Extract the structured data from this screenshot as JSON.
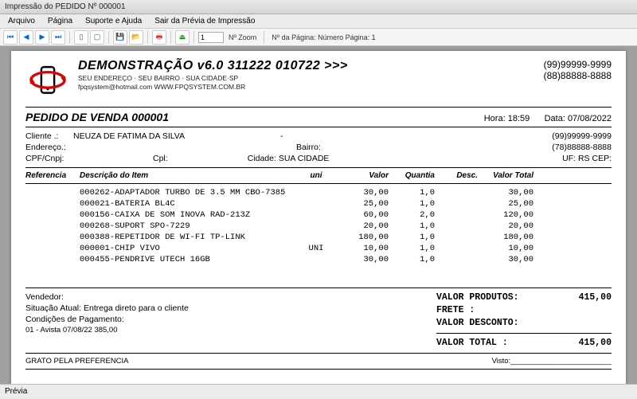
{
  "window": {
    "title": "Impressão do PEDIDO Nº 000001"
  },
  "menu": {
    "arquivo": "Arquivo",
    "pagina": "Página",
    "suporte": "Suporte e Ajuda",
    "sair": "Sair da Prévia de Impressão"
  },
  "toolbar": {
    "zoom_value": "1",
    "zoom_label": "Nº Zoom",
    "page_label": "Nº da Página: Número Página: 1"
  },
  "header": {
    "company_line": "DEMONSTRAÇÃO v6.0 311222 010722 >>>",
    "address": "SEU ENDEREÇO · SEU BAIRRO · SUA CIDADE·SP",
    "contact": "fpqsystem@hotmail.com  WWW.FPQSYSTEM.COM.BR",
    "phone1": "(99)99999-9999",
    "phone2": "(88)88888-8888"
  },
  "doc": {
    "title": "PEDIDO DE VENDA 000001",
    "hora_label": "Hora:",
    "hora": "18:59",
    "data_label": "Data:",
    "data": "07/08/2022"
  },
  "client": {
    "cliente_label": "Cliente   .:",
    "cliente": "NEUZA DE FATIMA DA SILVA",
    "cliente_dash": "-",
    "endereco_label": "Endereço.:",
    "bairro_label": "Bairro:",
    "cpf_label": "CPF/Cnpj:",
    "cpl_label": "Cpl:",
    "cidade_label": "Cidade:",
    "cidade": "SUA CIDADE",
    "uf_label": "UF:",
    "uf": "RS",
    "cep_label": "CEP:",
    "phone1": "(99)99999-9999",
    "phone2": "(78)88888-8888"
  },
  "cols": {
    "ref": "Referencia",
    "desc": "Descrição do Item",
    "uni": "uni",
    "valor": "Valor",
    "quant": "Quantia",
    "desc2": "Desc.",
    "total": "Valor Total"
  },
  "items": [
    {
      "ref": "",
      "desc": "000262-ADAPTADOR TURBO DE 3.5 MM CBO-7385",
      "uni": "",
      "valor": "30,00",
      "quant": "1,0",
      "descv": "",
      "total": "30,00"
    },
    {
      "ref": "",
      "desc": "000021-BATERIA BL4C",
      "uni": "",
      "valor": "25,00",
      "quant": "1,0",
      "descv": "",
      "total": "25,00"
    },
    {
      "ref": "",
      "desc": "000156-CAIXA DE SOM INOVA RAD-213Z",
      "uni": "",
      "valor": "60,00",
      "quant": "2,0",
      "descv": "",
      "total": "120,00"
    },
    {
      "ref": "",
      "desc": "000268-SUPORT SPO-7229",
      "uni": "",
      "valor": "20,00",
      "quant": "1,0",
      "descv": "",
      "total": "20,00"
    },
    {
      "ref": "",
      "desc": "000388-REPETIDOR DE WI-FI TP-LINK",
      "uni": "",
      "valor": "180,00",
      "quant": "1,0",
      "descv": "",
      "total": "180,00"
    },
    {
      "ref": "",
      "desc": "000001-CHIP VIVO",
      "uni": "UNI",
      "valor": "10,00",
      "quant": "1,0",
      "descv": "",
      "total": "10,00"
    },
    {
      "ref": "",
      "desc": "000455-PENDRIVE UTECH 16GB",
      "uni": "",
      "valor": "30,00",
      "quant": "1,0",
      "descv": "",
      "total": "30,00"
    }
  ],
  "bottom": {
    "vendedor_label": "Vendedor:",
    "situacao_label": "Situação Atual:",
    "situacao": "Entrega direto para o cliente",
    "cond_label": "Condições de Pagamento:",
    "pag_line": "01 - Avista    07/08/22    385,00",
    "thanks": "GRATO PELA PREFERENCIA",
    "visto": "Visto:________________________"
  },
  "totals": {
    "produtos_l": "VALOR PRODUTOS:",
    "produtos_v": "415,00",
    "frete_l": "FRETE         :",
    "frete_v": "",
    "desconto_l": "VALOR DESCONTO:",
    "desconto_v": "",
    "total_l": "VALOR TOTAL   :",
    "total_v": "415,00"
  },
  "status": {
    "text": "Prévia"
  }
}
